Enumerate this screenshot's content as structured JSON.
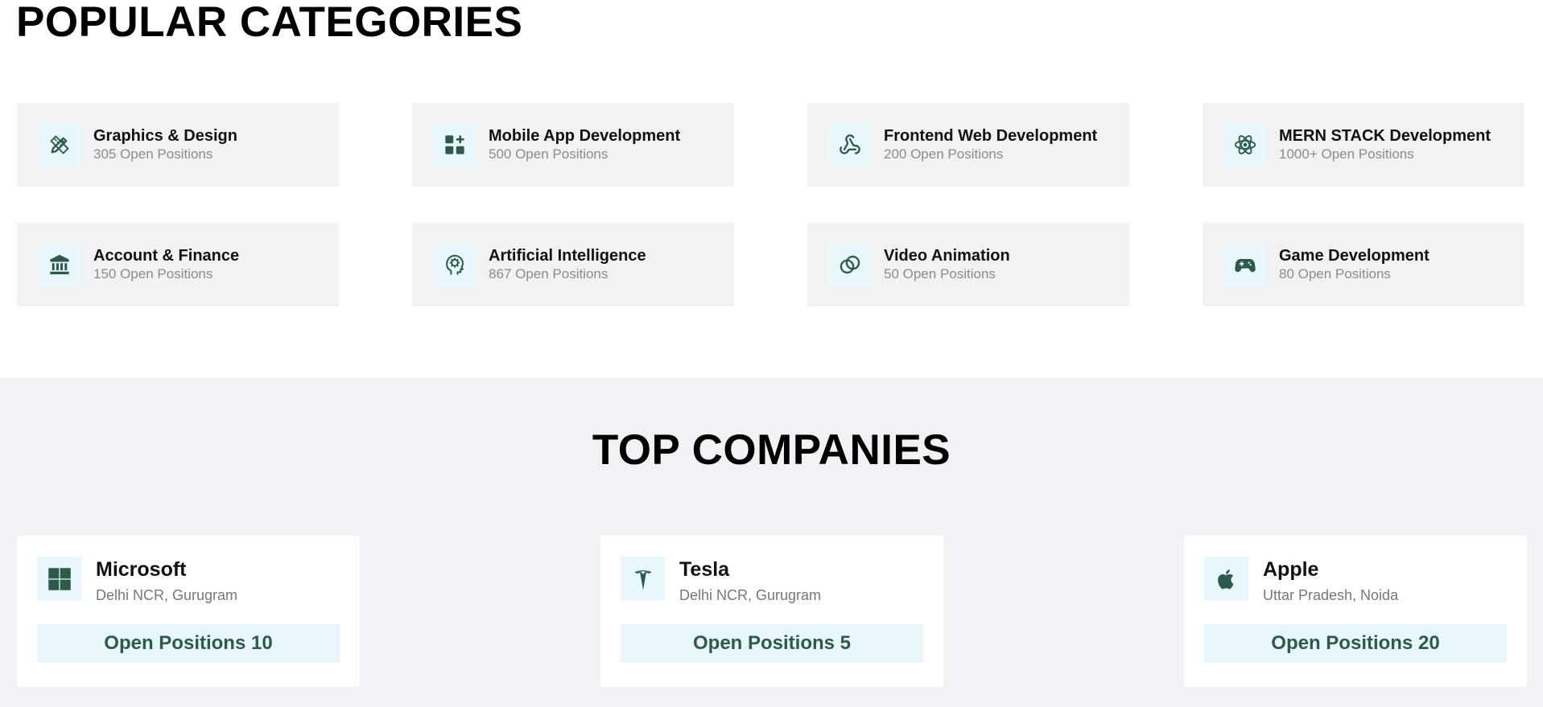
{
  "popular": {
    "title": "POPULAR CATEGORIES",
    "categories": [
      {
        "title": "Graphics & Design",
        "positions": "305 Open Positions",
        "icon": "pencil-ruler-icon"
      },
      {
        "title": "Mobile App Development",
        "positions": "500 Open Positions",
        "icon": "app-grid-plus-icon"
      },
      {
        "title": "Frontend Web Development",
        "positions": "200 Open Positions",
        "icon": "webhook-icon"
      },
      {
        "title": "MERN STACK Development",
        "positions": "1000+ Open Positions",
        "icon": "react-atom-icon"
      },
      {
        "title": "Account & Finance",
        "positions": "150 Open Positions",
        "icon": "bank-building-icon"
      },
      {
        "title": "Artificial Intelligence",
        "positions": "867 Open Positions",
        "icon": "brain-head-icon"
      },
      {
        "title": "Video Animation",
        "positions": "50 Open Positions",
        "icon": "rings-icon"
      },
      {
        "title": "Game Development",
        "positions": "80 Open Positions",
        "icon": "gamepad-icon"
      }
    ]
  },
  "companies": {
    "title": "TOP COMPANIES",
    "items": [
      {
        "name": "Microsoft",
        "location": "Delhi NCR, Gurugram",
        "button": "Open Positions 10",
        "icon": "microsoft-logo-icon"
      },
      {
        "name": "Tesla",
        "location": "Delhi NCR, Gurugram",
        "button": "Open Positions 5",
        "icon": "tesla-logo-icon"
      },
      {
        "name": "Apple",
        "location": "Uttar Pradesh, Noida",
        "button": "Open Positions 20",
        "icon": "apple-logo-icon"
      }
    ]
  },
  "colors": {
    "icon_green": "#2d5a4c",
    "icon_bg": "#e8f7fb",
    "card_bg": "#f1f2f4"
  }
}
